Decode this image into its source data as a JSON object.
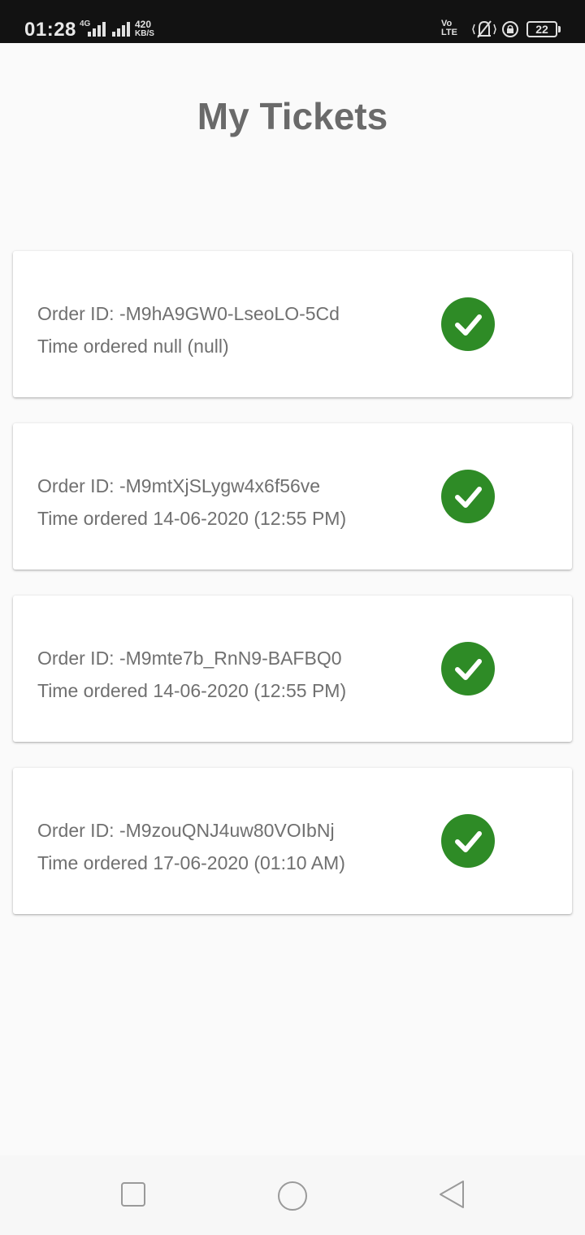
{
  "status_bar": {
    "time": "01:28",
    "network_type": "4G",
    "speed_value": "420",
    "speed_unit": "KB/S",
    "volte_top": "Vo",
    "volte_bottom": "LTE",
    "battery_level": "22",
    "icons": [
      "signal-icon",
      "signal-icon",
      "volte-icon",
      "vibrate-icon",
      "rotation-lock-icon",
      "battery-icon"
    ]
  },
  "header": {
    "title": "My Tickets"
  },
  "tickets": [
    {
      "order_id": "Order ID: -M9hA9GW0-LseoLO-5Cd",
      "time_ordered": "Time ordered null (null)",
      "status_icon": "check-icon"
    },
    {
      "order_id": "Order ID: -M9mtXjSLygw4x6f56ve",
      "time_ordered": "Time ordered 14-06-2020 (12:55 PM)",
      "status_icon": "check-icon"
    },
    {
      "order_id": "Order ID: -M9mte7b_RnN9-BAFBQ0",
      "time_ordered": "Time ordered 14-06-2020 (12:55 PM)",
      "status_icon": "check-icon"
    },
    {
      "order_id": "Order ID: -M9zouQNJ4uw80VOIbNj",
      "time_ordered": "Time ordered 17-06-2020 (01:10 AM)",
      "status_icon": "check-icon"
    }
  ],
  "colors": {
    "status_bar_bg": "#121212",
    "check_green": "#2e8b26",
    "title_gray": "#6a6a6a",
    "text_gray": "#707070"
  },
  "nav_bar": {
    "buttons": [
      "recents-square-icon",
      "home-circle-icon",
      "back-triangle-icon"
    ]
  }
}
